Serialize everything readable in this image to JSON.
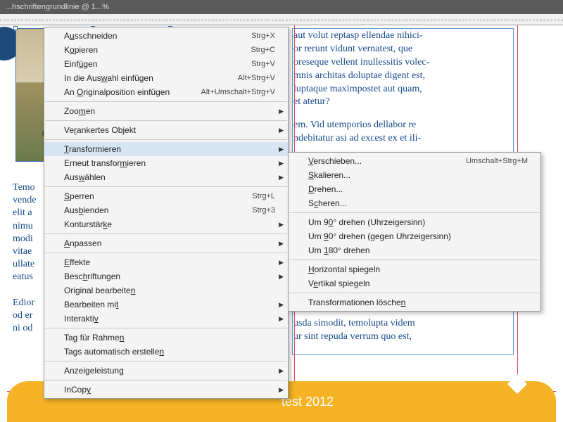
{
  "title_bar": "...hschriftengrundlinie @ 1...%",
  "footer_text": "test 2012",
  "left_text": "Temo\nvende\nelit a\nnimu\nmodi\nvitae\nullate\neatus\n\nEdior\nod er\nni od",
  "right_paragraphs": [
    "aut volut reptasp ellendae nihici-\nor rerunt vidunt vernatest, que\noreseque vellent inullessitis volec-\nmnis architas doluptae digent est,\nluptaque maximpostet aut quam,\net atetur?",
    "em. Vid utemporios dellabor re\nndebitatur asi ad excest ex et ili-",
    "usda simodit, temolupta videm\nur sint repuda verrum quo est,"
  ],
  "menu1": {
    "groups": [
      [
        {
          "label_pre": "A",
          "u": "u",
          "label_post": "sschneiden",
          "shortcut": "Strg+X"
        },
        {
          "label_pre": "K",
          "u": "o",
          "label_post": "pieren",
          "shortcut": "Strg+C"
        },
        {
          "label_pre": "Einf",
          "u": "ü",
          "label_post": "gen",
          "shortcut": "Strg+V"
        },
        {
          "label_pre": "In die Aus",
          "u": "w",
          "label_post": "ahl einfügen",
          "shortcut": "Alt+Strg+V"
        },
        {
          "label_pre": "An ",
          "u": "O",
          "label_post": "riginalposition einfügen",
          "shortcut": "Alt+Umschalt+Strg+V"
        }
      ],
      [
        {
          "label_pre": "Zoo",
          "u": "m",
          "label_post": "en",
          "sub": true
        }
      ],
      [
        {
          "label_pre": "Ve",
          "u": "r",
          "label_post": "ankertes Objekt",
          "sub": true
        }
      ],
      [
        {
          "label_pre": "",
          "u": "T",
          "label_post": "ransformieren",
          "sub": true,
          "hi": true
        },
        {
          "label_pre": "Erneut transfor",
          "u": "m",
          "label_post": "ieren",
          "sub": true
        },
        {
          "label_pre": "Aus",
          "u": "w",
          "label_post": "ählen",
          "sub": true
        }
      ],
      [
        {
          "label_pre": "",
          "u": "S",
          "label_post": "perren",
          "shortcut": "Strg+L"
        },
        {
          "label_pre": "Aus",
          "u": "b",
          "label_post": "lenden",
          "shortcut": "Strg+3"
        },
        {
          "label_pre": "Konturstär",
          "u": "k",
          "label_post": "e",
          "sub": true
        }
      ],
      [
        {
          "label_pre": "",
          "u": "A",
          "label_post": "npassen",
          "sub": true
        }
      ],
      [
        {
          "label_pre": "",
          "u": "E",
          "label_post": "ffekte",
          "sub": true
        },
        {
          "label_pre": "Besc",
          "u": "h",
          "label_post": "riftungen",
          "sub": true
        },
        {
          "label_pre": "Original bearbeite",
          "u": "n",
          "label_post": ""
        },
        {
          "label_pre": "Bearbeiten mi",
          "u": "t",
          "label_post": "",
          "sub": true
        },
        {
          "label_pre": "Interakti",
          "u": "v",
          "label_post": "",
          "sub": true
        }
      ],
      [
        {
          "label_pre": "Tag für Rahme",
          "u": "n",
          "label_post": ""
        },
        {
          "label_pre": "Tags automatisch erstelle",
          "u": "n",
          "label_post": ""
        }
      ],
      [
        {
          "label_pre": "Anzeigeleistun",
          "u": "g",
          "label_post": "",
          "sub": true
        }
      ],
      [
        {
          "label_pre": "InCop",
          "u": "y",
          "label_post": "",
          "sub": true
        }
      ]
    ]
  },
  "menu2": {
    "groups": [
      [
        {
          "label_pre": "",
          "u": "V",
          "label_post": "erschieben...",
          "shortcut": "Umschalt+Strg+M"
        },
        {
          "label_pre": "",
          "u": "S",
          "label_post": "kalieren..."
        },
        {
          "label_pre": "",
          "u": "D",
          "label_post": "rehen..."
        },
        {
          "label_pre": "S",
          "u": "c",
          "label_post": "heren..."
        }
      ],
      [
        {
          "label_pre": "Um 9",
          "u": "0",
          "label_post": "° drehen (Uhrzeigersinn)"
        },
        {
          "label_pre": "Um ",
          "u": "9",
          "label_post": "0° drehen (gegen Uhrzeigersinn)"
        },
        {
          "label_pre": "Um ",
          "u": "1",
          "label_post": "80° drehen"
        }
      ],
      [
        {
          "label_pre": "",
          "u": "H",
          "label_post": "orizontal spiegeln"
        },
        {
          "label_pre": "V",
          "u": "e",
          "label_post": "rtikal spiegeln"
        }
      ],
      [
        {
          "label_pre": "Transformationen lösche",
          "u": "n",
          "label_post": ""
        }
      ]
    ]
  }
}
